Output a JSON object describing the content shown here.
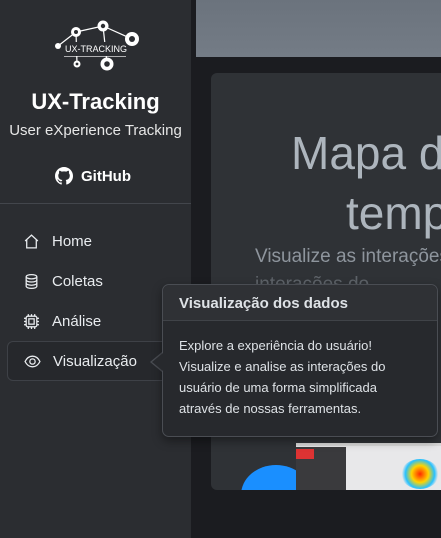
{
  "sidebar": {
    "logo_text": "UX-TRACKING",
    "title": "UX-Tracking",
    "subtitle": "User eXperience Tracking",
    "github_label": "GitHub",
    "items": [
      {
        "label": "Home",
        "icon": "home-icon"
      },
      {
        "label": "Coletas",
        "icon": "database-icon"
      },
      {
        "label": "Análise",
        "icon": "cpu-icon"
      },
      {
        "label": "Visualização",
        "icon": "eye-icon",
        "active": true
      }
    ]
  },
  "hero": {
    "title_line1": "Mapa d",
    "title_line2": "temp",
    "text_line1": "Visualize as interações",
    "text_line2": "interações do"
  },
  "popover": {
    "title": "Visualização dos dados",
    "body": "Explore a experiência do usuário! Visualize e analise as interações do usuário de uma forma simplificada através de nossas ferramentas."
  },
  "colors": {
    "sidebar_bg": "#2b2d31",
    "main_bg": "#1b1c20",
    "card_bg": "#2f3236",
    "popover_bg": "#27292d"
  }
}
